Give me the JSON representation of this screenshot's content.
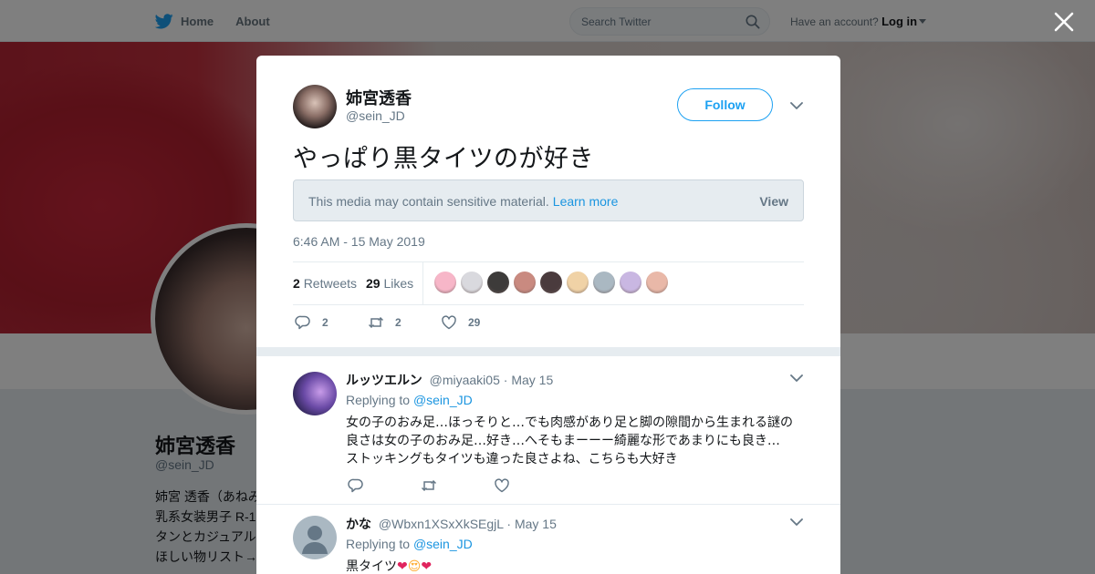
{
  "topbar": {
    "home_label": "Home",
    "about_label": "About",
    "search_placeholder": "Search Twitter",
    "account_prompt": "Have an account?",
    "login_label": "Log in"
  },
  "profile": {
    "name": "姉宮透香",
    "handle": "@sein_JD",
    "bio_lines": [
      "姉宮 透香（あねみ",
      "乳系女装男子 R-1",
      "タンとカジュアル",
      "ほしい物リスト→"
    ]
  },
  "tweet": {
    "author_name": "姉宮透香",
    "author_handle": "@sein_JD",
    "follow_label": "Follow",
    "text": "やっぱり黒タイツのが好き",
    "sensitive_message": "This media may contain sensitive material.",
    "learn_more_label": "Learn more",
    "view_label": "View",
    "timestamp": "6:46 AM - 15 May 2019",
    "retweets_count": "2",
    "retweets_label": "Retweets",
    "likes_count": "29",
    "likes_label": "Likes",
    "actions": {
      "replies": "2",
      "retweets": "2",
      "likes": "29"
    },
    "liker_colors": [
      "#f7b6c8",
      "#d9d9de",
      "#3d3b3a",
      "#c98a80",
      "#4a3b3d",
      "#f0d2a6",
      "#aab8c2",
      "#c9b7e2",
      "#e9b8a8"
    ]
  },
  "replies": [
    {
      "name": "ルッツエルン",
      "handle": "@miyaaki05",
      "date": "· May 15",
      "replying_prefix": "Replying to",
      "replying_to": "@sein_JD",
      "lines": [
        "女の子のおみ足…ほっそりと…でも肉感があり足と脚の隙間から生まれる謎の",
        "良さは女の子のおみ足…好き…へそもまーーー綺麗な形であまりにも良き…",
        "ストッキングもタイツも違った良さよね、こちらも大好き"
      ]
    },
    {
      "name": "かな",
      "handle": "@Wbxn1XSxXkSEgjL",
      "date": "· May 15",
      "replying_prefix": "Replying to",
      "replying_to": "@sein_JD",
      "text": "黒タイツ",
      "emoji": [
        "❤",
        "😍",
        "❤"
      ]
    }
  ],
  "colors": {
    "accent": "#1da1f2",
    "link": "#1b95e0",
    "muted": "#657786"
  }
}
